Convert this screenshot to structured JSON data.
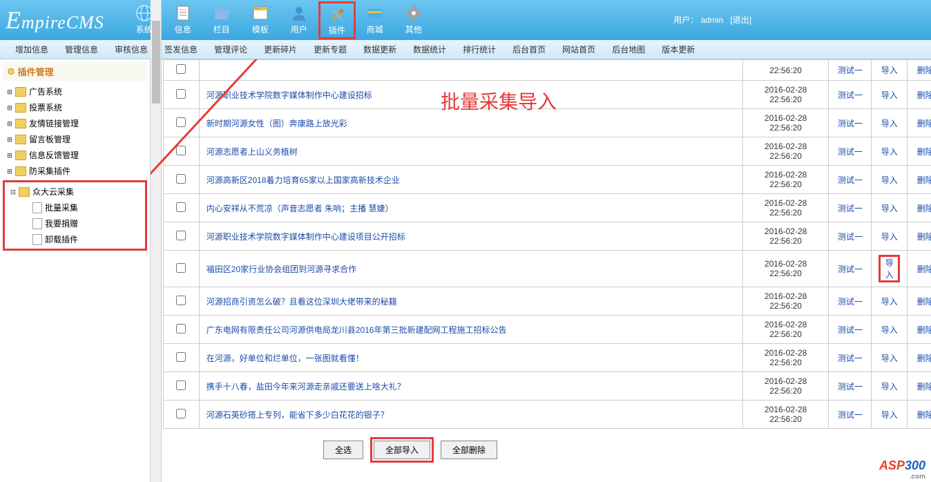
{
  "logo": "EmpireCMS",
  "nav": [
    {
      "label": "系统",
      "icon": "globe"
    },
    {
      "label": "信息",
      "icon": "doc"
    },
    {
      "label": "栏目",
      "icon": "folder"
    },
    {
      "label": "模板",
      "icon": "window"
    },
    {
      "label": "用户",
      "icon": "user"
    },
    {
      "label": "插件",
      "icon": "tools",
      "highlight": true
    },
    {
      "label": "商城",
      "icon": "card"
    },
    {
      "label": "其他",
      "icon": "gear"
    }
  ],
  "user_label": "用户：",
  "user_name": "admin",
  "logout": "[退出]",
  "subnav": [
    "增加信息",
    "管理信息",
    "审核信息",
    "签发信息",
    "管理评论",
    "更新碎片",
    "更新专题",
    "数据更新",
    "数据统计",
    "排行统计",
    "后台首页",
    "网站首页",
    "后台地图",
    "版本更新"
  ],
  "sidebar_title": "插件管理",
  "tree_items": [
    {
      "label": "广告系统",
      "type": "folder"
    },
    {
      "label": "投票系统",
      "type": "folder"
    },
    {
      "label": "友情链接管理",
      "type": "folder"
    },
    {
      "label": "留言板管理",
      "type": "folder"
    },
    {
      "label": "信息反馈管理",
      "type": "folder"
    },
    {
      "label": "防采集插件",
      "type": "folder"
    }
  ],
  "special_tree": {
    "parent": "众大云采集",
    "children": [
      "批量采集",
      "我要捐赠",
      "卸载插件"
    ]
  },
  "annotation_text": "批量采集导入",
  "rows": [
    {
      "title": "河源职业技术学院数字媒体制作中心建设招标",
      "date": "2016-02-28",
      "time": "22:56:20",
      "user": "测试一"
    },
    {
      "title": "新时期河源女性（图）奔康路上放光彩",
      "date": "2016-02-28",
      "time": "22:56:20",
      "user": "测试一"
    },
    {
      "title": "河源志愿者上山义务植树",
      "date": "2016-02-28",
      "time": "22:56:20",
      "user": "测试一"
    },
    {
      "title": "河源高新区2018着力培育65家以上国家高新技术企业",
      "date": "2016-02-28",
      "time": "22:56:20",
      "user": "测试一"
    },
    {
      "title": "内心安祥从不荒凉（声音志愿者 朱响；主播 慧婕）",
      "date": "2016-02-28",
      "time": "22:56:20",
      "user": "测试一"
    },
    {
      "title": "河源职业技术学院数字媒体制作中心建设项目公开招标",
      "date": "2016-02-28",
      "time": "22:56:20",
      "user": "测试一"
    },
    {
      "title": "福田区20家行业协会组团到河源寻求合作",
      "date": "2016-02-28",
      "time": "22:56:20",
      "user": "测试一",
      "import_highlight": true
    },
    {
      "title": "河源招商引资怎么破？且看这位深圳大佬带来的秘籍",
      "date": "2016-02-28",
      "time": "22:56:20",
      "user": "测试一"
    },
    {
      "title": "广东电网有限责任公司河源供电局龙川县2016年第三批新建配网工程施工招标公告",
      "date": "2016-02-28",
      "time": "22:56:20",
      "user": "测试一"
    },
    {
      "title": "在河源，好单位和烂单位，一张图就看懂！",
      "date": "2016-02-28",
      "time": "22:56:20",
      "user": "测试一"
    },
    {
      "title": "携手十八春，盐田今年来河源走亲戚还要送上啥大礼？",
      "date": "2016-02-28",
      "time": "22:56:20",
      "user": "测试一"
    },
    {
      "title": "河源石英砂搭上专列，能省下多少白花花的银子？",
      "date": "2016-02-28",
      "time": "22:56:20",
      "user": "测试一"
    }
  ],
  "partial_row": {
    "time": "22:56:20",
    "user": "测试一"
  },
  "import_label": "导入",
  "delete_label": "删除",
  "buttons": {
    "select_all": "全选",
    "import_all": "全部导入",
    "delete_all": "全部删除"
  },
  "watermark": {
    "asp": "ASP",
    "three": "300",
    "com": ".com"
  }
}
